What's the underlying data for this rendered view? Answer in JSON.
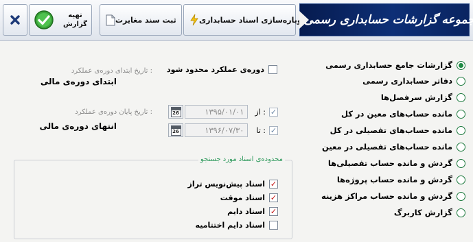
{
  "toolbar": {
    "banner_title": "مجموعه گزارشات حسابداری رسمی",
    "duplicate_label": "دوباره‌سازی اسناد حسابداری",
    "discrepancy_label": "ثبت سند مغایرت",
    "prepare_label_line1": "تهیه",
    "prepare_label_line2": "گزارش",
    "icons": {
      "close": "close-icon",
      "prepare": "checkmark-icon",
      "discrepancy": "document-icon",
      "duplicate": "lightning-icon"
    }
  },
  "report_types": [
    {
      "label": "گزارشات جامع حسابداری رسمی",
      "selected": true
    },
    {
      "label": "دفاتر حسابداری رسمی",
      "selected": false
    },
    {
      "label": "گزارش سرفصل‌ها",
      "selected": false
    },
    {
      "label": "مانده حساب‌های معین در کل",
      "selected": false
    },
    {
      "label": "مانده حساب‌های تفصیلی در کل",
      "selected": false
    },
    {
      "label": "مانده حساب‌های تفصیلی در معین",
      "selected": false
    },
    {
      "label": "گردش و مانده حساب تفصیلی‌ها",
      "selected": false
    },
    {
      "label": "گردش و مانده حساب پروژه‌ها",
      "selected": false
    },
    {
      "label": "گردش و مانده حساب مراکز هزینه",
      "selected": false
    },
    {
      "label": "گزارش کاربرگ",
      "selected": false
    }
  ],
  "period": {
    "limit_label": "دوره‌ی عملکرد محدود شود",
    "limit_checked": false,
    "start_hint": "تاریخ ابتدای دوره‌ی عملکرد :",
    "start_value": "ابتدای دوره‌ی مالی",
    "end_hint": "تاریخ پایان دوره‌ی عملکرد :",
    "end_value": "انتهای دوره‌ی مالی",
    "from_label": "از :",
    "from_date": "۱۳۹۵/۰۱/۰۱",
    "from_checked": true,
    "to_label": "تا :",
    "to_date": "۱۳۹۶/۰۷/۳۰",
    "to_checked": true,
    "calendar_day": "26"
  },
  "documents": {
    "group_title": "محدوده‌ی اسناد مورد جستجو",
    "items": [
      {
        "label": "اسناد پیش‌نویس تراز",
        "checked": true
      },
      {
        "label": "اسناد موقت",
        "checked": true
      },
      {
        "label": "اسناد دایم",
        "checked": true
      },
      {
        "label": "اسناد دایم اختتامیه",
        "checked": false
      }
    ]
  },
  "colors": {
    "banner_bg": "#0d2f76",
    "radio_green": "#1f8a44",
    "group_title_green": "#2f9a5d",
    "check_red": "#c31313"
  }
}
